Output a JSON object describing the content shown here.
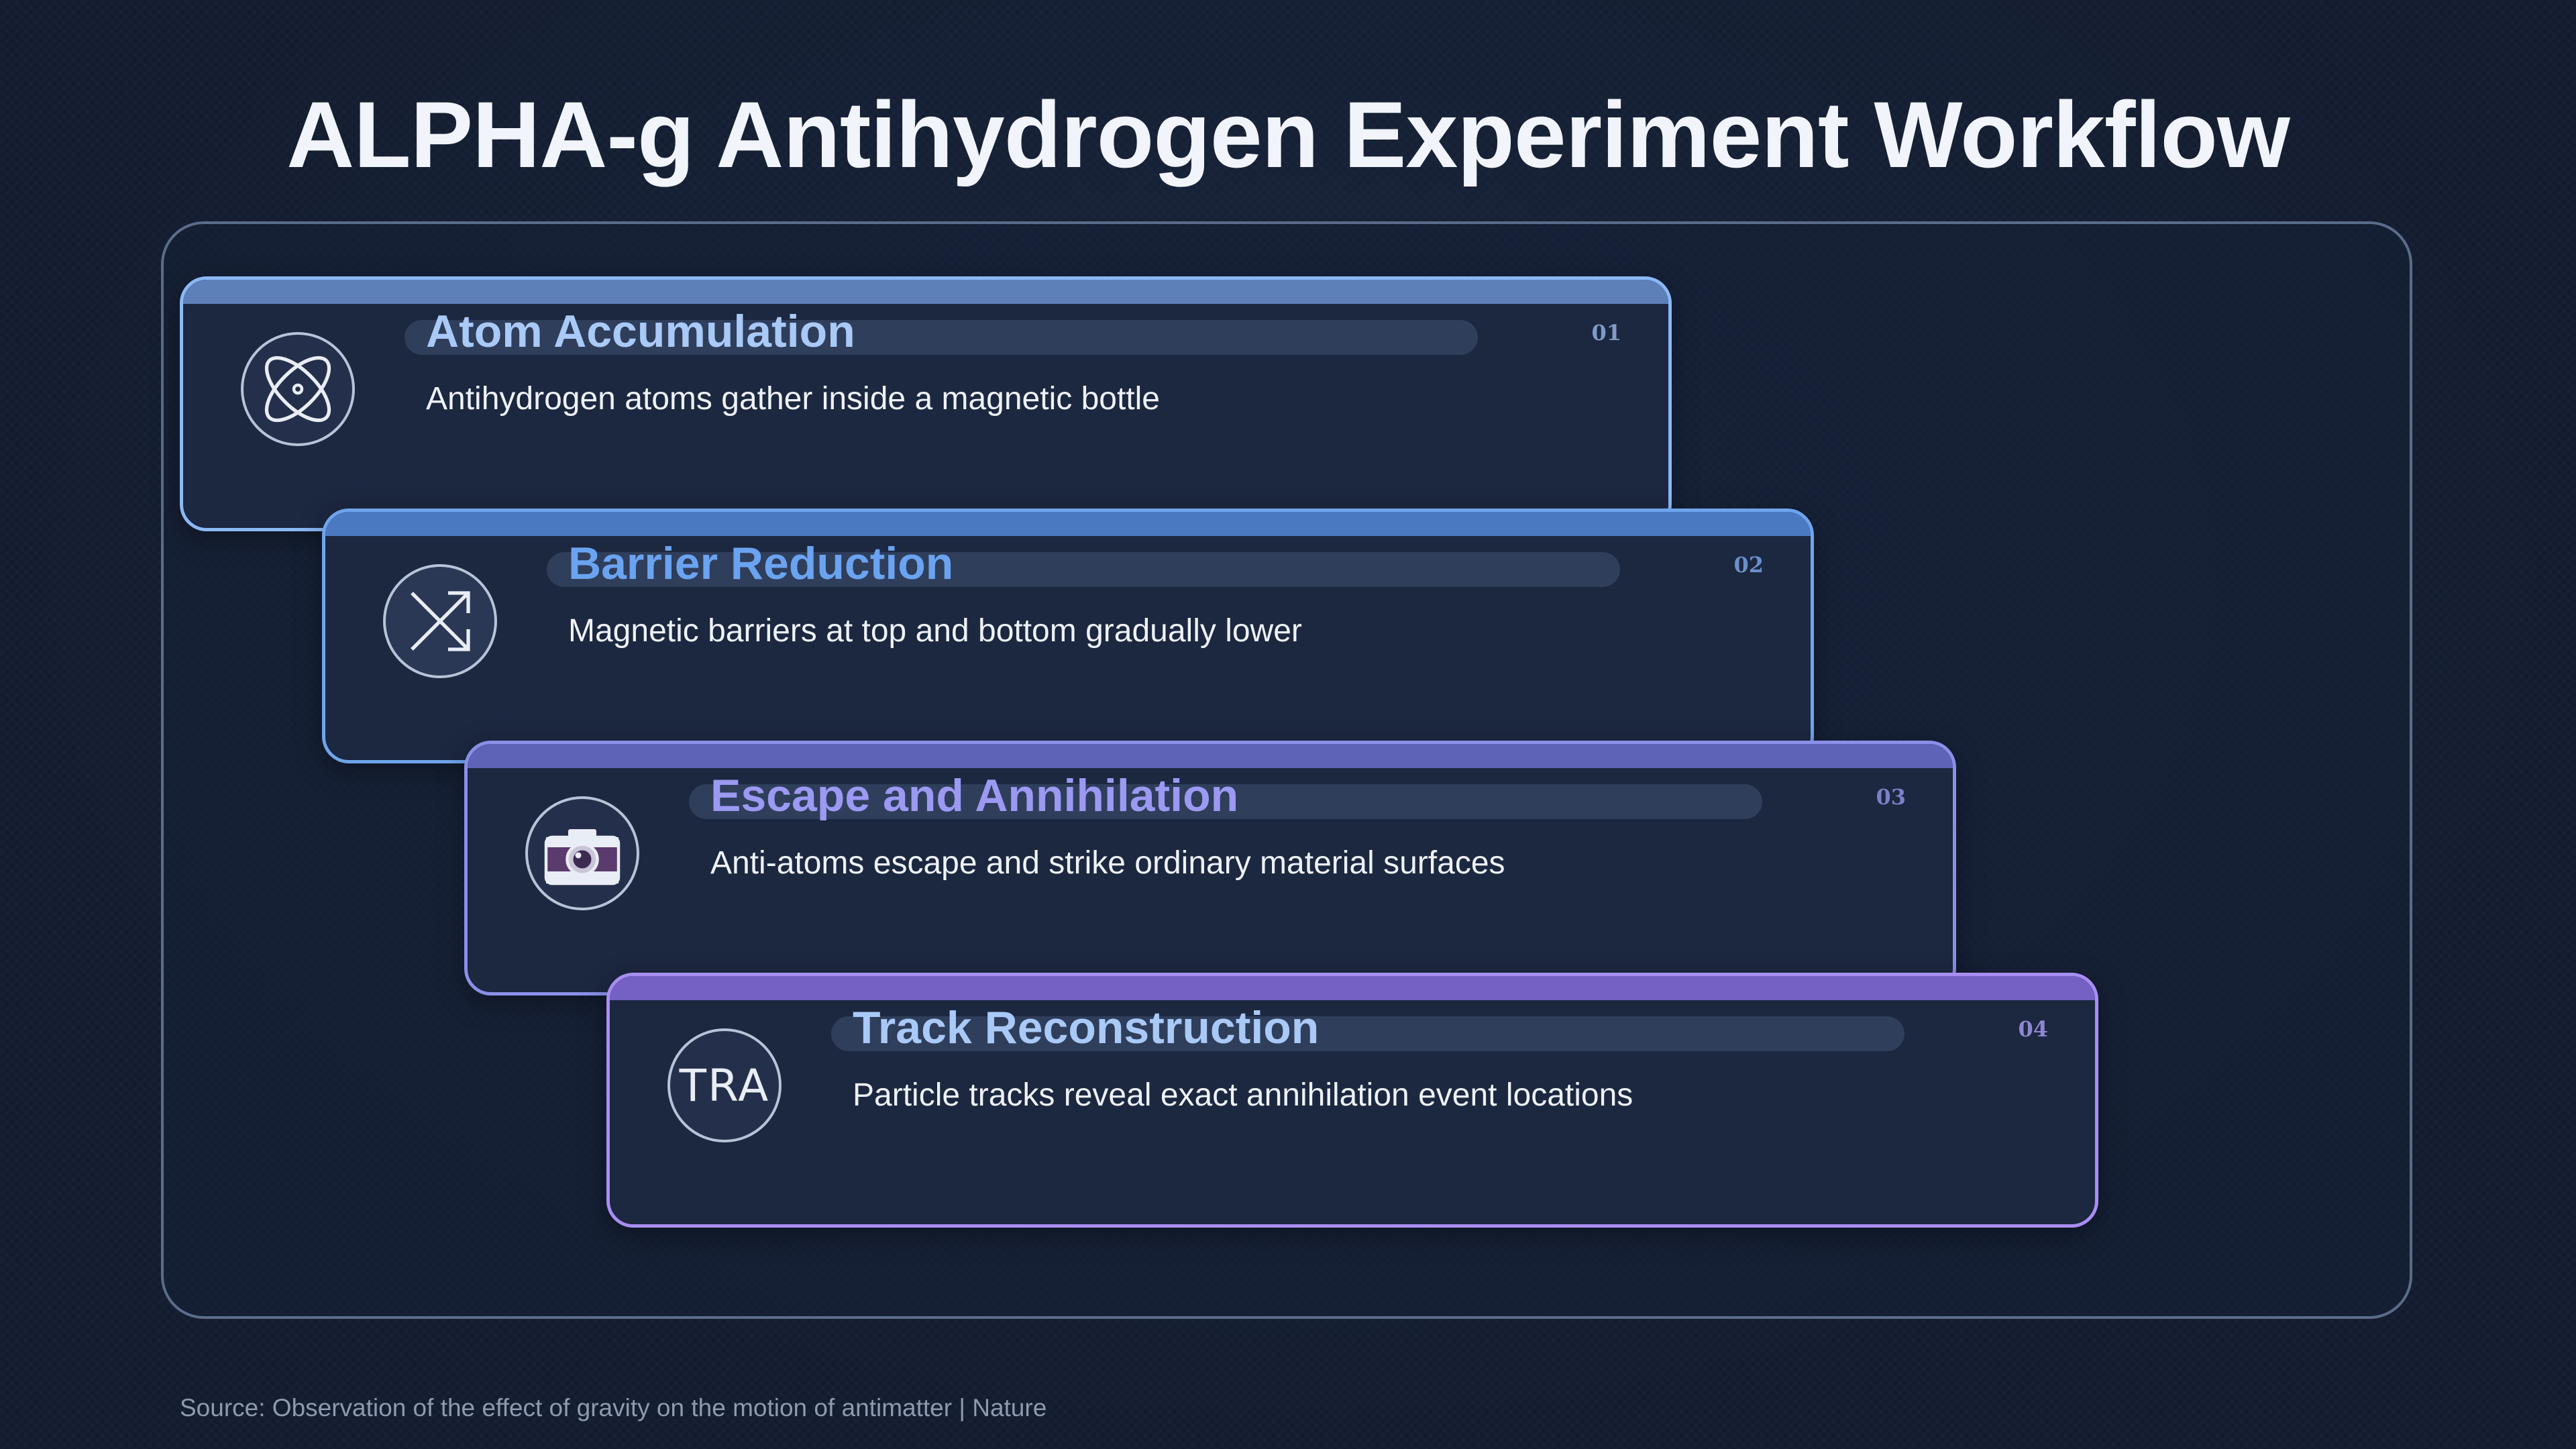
{
  "title": "ALPHA-g Antihydrogen Experiment Workflow",
  "steps": [
    {
      "number": "01",
      "title": "Atom Accumulation",
      "description": "Antihydrogen atoms gather inside a magnetic bottle",
      "icon": "atom-icon",
      "title_color": "#a9c9f7",
      "accent": "#8bb8f5"
    },
    {
      "number": "02",
      "title": "Barrier Reduction",
      "description": "Magnetic barriers at top and bottom gradually lower",
      "icon": "arrows-expand-icon",
      "title_color": "#6aa3f0",
      "accent": "#5b96e6"
    },
    {
      "number": "03",
      "title": "Escape and Annihilation",
      "description": "Anti-atoms escape and strike ordinary material surfaces",
      "icon": "camera-icon",
      "title_color": "#9b99f2",
      "accent": "#7f7fe8"
    },
    {
      "number": "04",
      "title": "Track Reconstruction",
      "description": "Particle tracks reveal exact annihilation event locations",
      "icon": "tra-icon",
      "icon_text": "TRA",
      "title_color": "#a9c9f7",
      "accent": "#a98ef2"
    }
  ],
  "footer": {
    "source": "Source: Observation of the effect of gravity on the motion of antimatter | Nature"
  }
}
